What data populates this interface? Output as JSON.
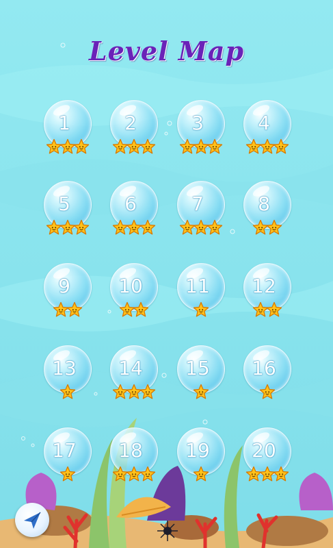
{
  "title": "Level Map",
  "colors": {
    "title": "#6a22b8",
    "water": "#8ee6ef",
    "star_fill": "#ffc21a",
    "star_stroke": "#d87a00"
  },
  "levels": [
    {
      "number": "1",
      "stars": 3
    },
    {
      "number": "2",
      "stars": 3
    },
    {
      "number": "3",
      "stars": 3
    },
    {
      "number": "4",
      "stars": 3
    },
    {
      "number": "5",
      "stars": 3
    },
    {
      "number": "6",
      "stars": 3
    },
    {
      "number": "7",
      "stars": 3
    },
    {
      "number": "8",
      "stars": 2
    },
    {
      "number": "9",
      "stars": 2
    },
    {
      "number": "10",
      "stars": 2
    },
    {
      "number": "11",
      "stars": 1
    },
    {
      "number": "12",
      "stars": 2
    },
    {
      "number": "13",
      "stars": 1
    },
    {
      "number": "14",
      "stars": 3
    },
    {
      "number": "15",
      "stars": 1
    },
    {
      "number": "16",
      "stars": 1
    },
    {
      "number": "17",
      "stars": 1
    },
    {
      "number": "18",
      "stars": 3
    },
    {
      "number": "19",
      "stars": 1
    },
    {
      "number": "20",
      "stars": 3
    }
  ],
  "back_button": {
    "icon": "paper-plane-arrow-icon"
  }
}
